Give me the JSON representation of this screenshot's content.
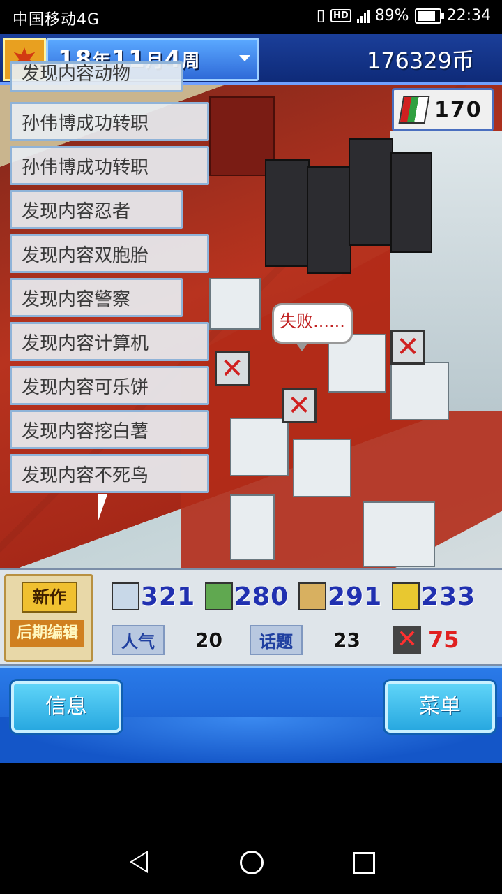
{
  "status": {
    "carrier": "中国移动4G",
    "network": "4G",
    "battery": "89%",
    "battery_level": 0.89,
    "time": "22:34"
  },
  "header": {
    "year": "18",
    "year_unit": "年",
    "month": "11",
    "month_unit": "月",
    "week": "4",
    "week_unit": "周",
    "coins": "176329币",
    "fans": "170"
  },
  "log": {
    "items": [
      "发现内容动物",
      "孙伟博成功转职",
      "孙伟博成功转职",
      "发现内容忍者",
      "发现内容双胞胎",
      "发现内容警察",
      "发现内容计算机",
      "发现内容可乐饼",
      "发现内容挖白薯",
      "发现内容不死鸟"
    ]
  },
  "scene": {
    "bubble": "失败......"
  },
  "stats": {
    "project_type": "新作",
    "project_stage": "后期编辑",
    "fun": "321",
    "creativity": "280",
    "graphics": "291",
    "sound": "233",
    "popularity_label": "人气",
    "popularity": "20",
    "topic_label": "话题",
    "topic": "23",
    "bugs": "75"
  },
  "buttons": {
    "info": "信息",
    "menu": "菜单"
  },
  "colors": {
    "accent_blue": "#1456c8",
    "button_cyan": "#28a8e0",
    "bug_red": "#e02020"
  }
}
